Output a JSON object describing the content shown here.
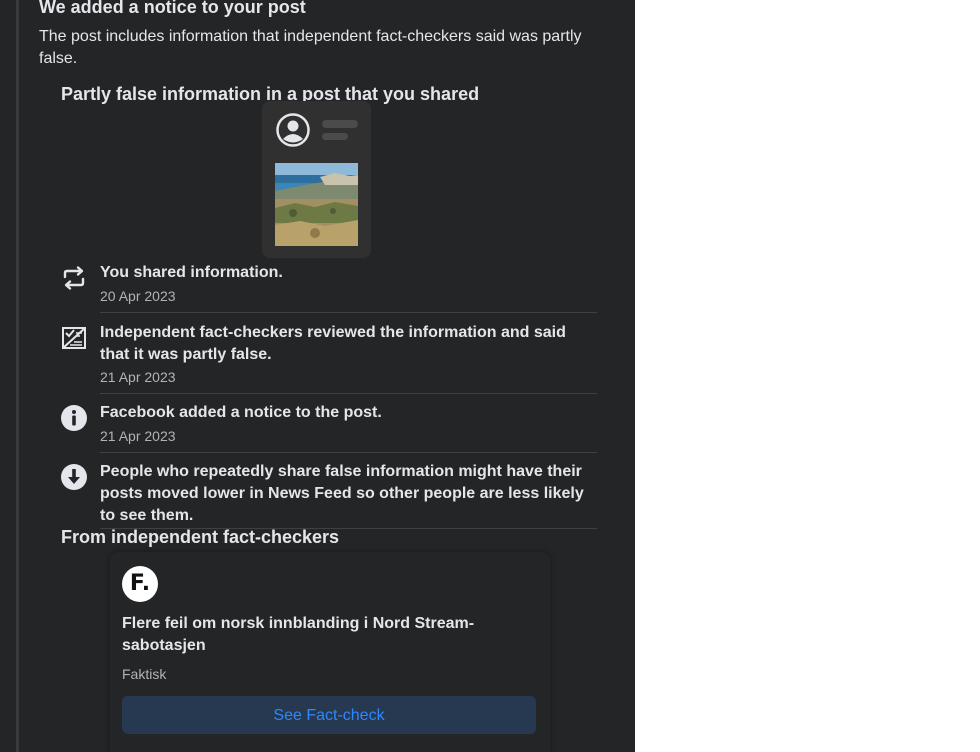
{
  "notice": {
    "heading": "We added a notice to your post",
    "description": "The post includes information that independent fact-checkers said was partly false.",
    "section_title": "Partly false information in a post that you shared"
  },
  "timeline": [
    {
      "icon": "share-repeat-icon",
      "text": "You shared information.",
      "date": "20 Apr 2023"
    },
    {
      "icon": "fact-check-icon",
      "text": "Independent fact-checkers reviewed the information and said that it was partly false.",
      "date": "21 Apr 2023"
    },
    {
      "icon": "info-icon",
      "text": "Facebook added a notice to the post.",
      "date": "21 Apr 2023"
    },
    {
      "icon": "arrow-down-circle-icon",
      "text": "People who repeatedly share false information might have their posts moved lower in News Feed so other people are less likely to see them.",
      "date": ""
    }
  ],
  "fact_checkers": {
    "section_title": "From independent fact-checkers",
    "logo_text": "F.",
    "article_title": "Flere feil om norsk innblanding i Nord Stream-sabotasjen",
    "source": "Faktisk",
    "button_label": "See Fact-check"
  },
  "colors": {
    "background": "#242526",
    "text_primary": "#e4e6eb",
    "text_secondary": "#b0b3b8",
    "button_bg": "#263951",
    "button_text": "#2d88ff"
  }
}
